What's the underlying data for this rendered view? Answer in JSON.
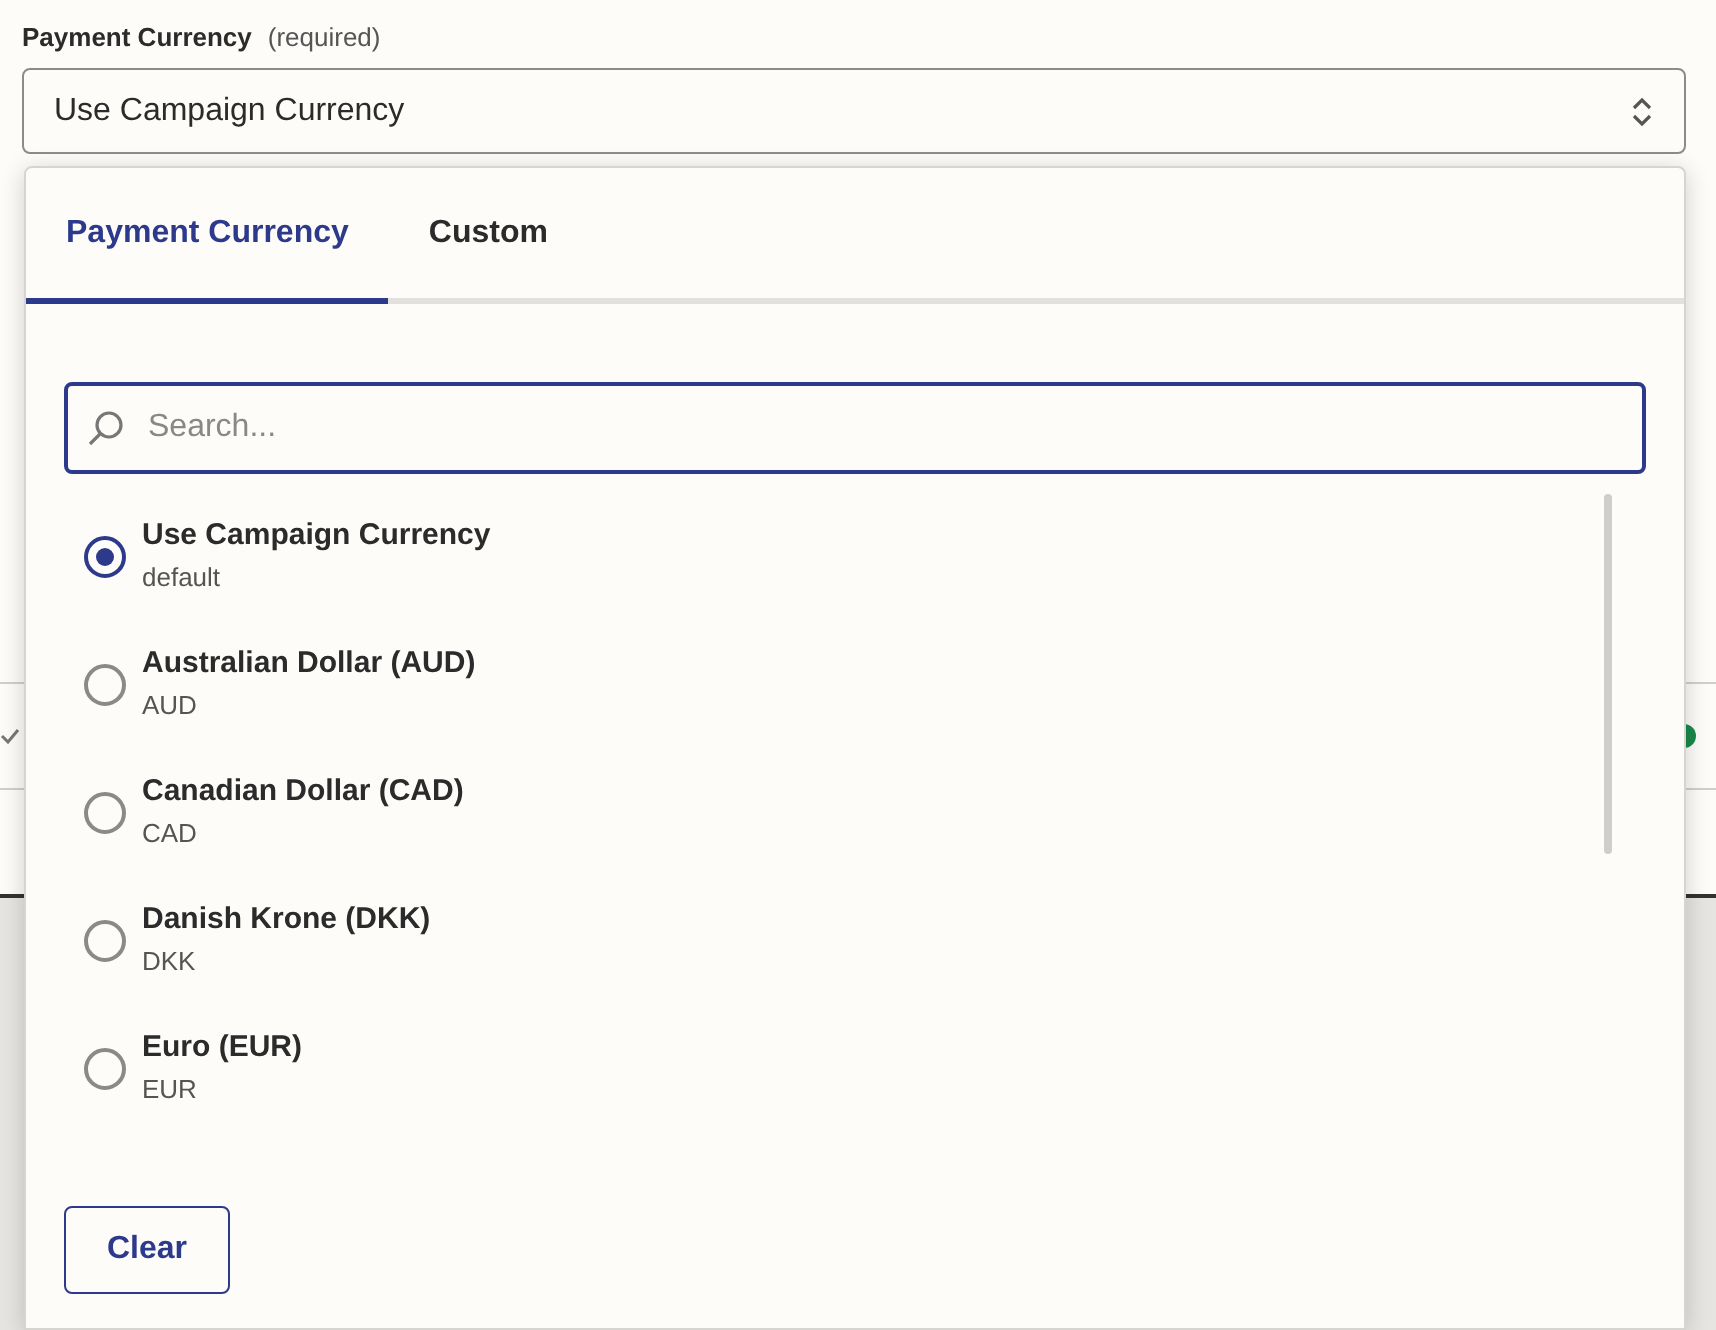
{
  "field": {
    "label": "Payment Currency",
    "hint": "(required)",
    "value": "Use Campaign Currency"
  },
  "tabs": [
    {
      "label": "Payment Currency",
      "selected": true
    },
    {
      "label": "Custom",
      "selected": false
    }
  ],
  "search": {
    "placeholder": "Search..."
  },
  "options": [
    {
      "title": "Use Campaign Currency",
      "code": "default",
      "selected": true
    },
    {
      "title": "Australian Dollar (AUD)",
      "code": "AUD",
      "selected": false
    },
    {
      "title": "Canadian Dollar (CAD)",
      "code": "CAD",
      "selected": false
    },
    {
      "title": "Danish Krone (DKK)",
      "code": "DKK",
      "selected": false
    },
    {
      "title": "Euro (EUR)",
      "code": "EUR",
      "selected": false
    }
  ],
  "button": "Clear"
}
